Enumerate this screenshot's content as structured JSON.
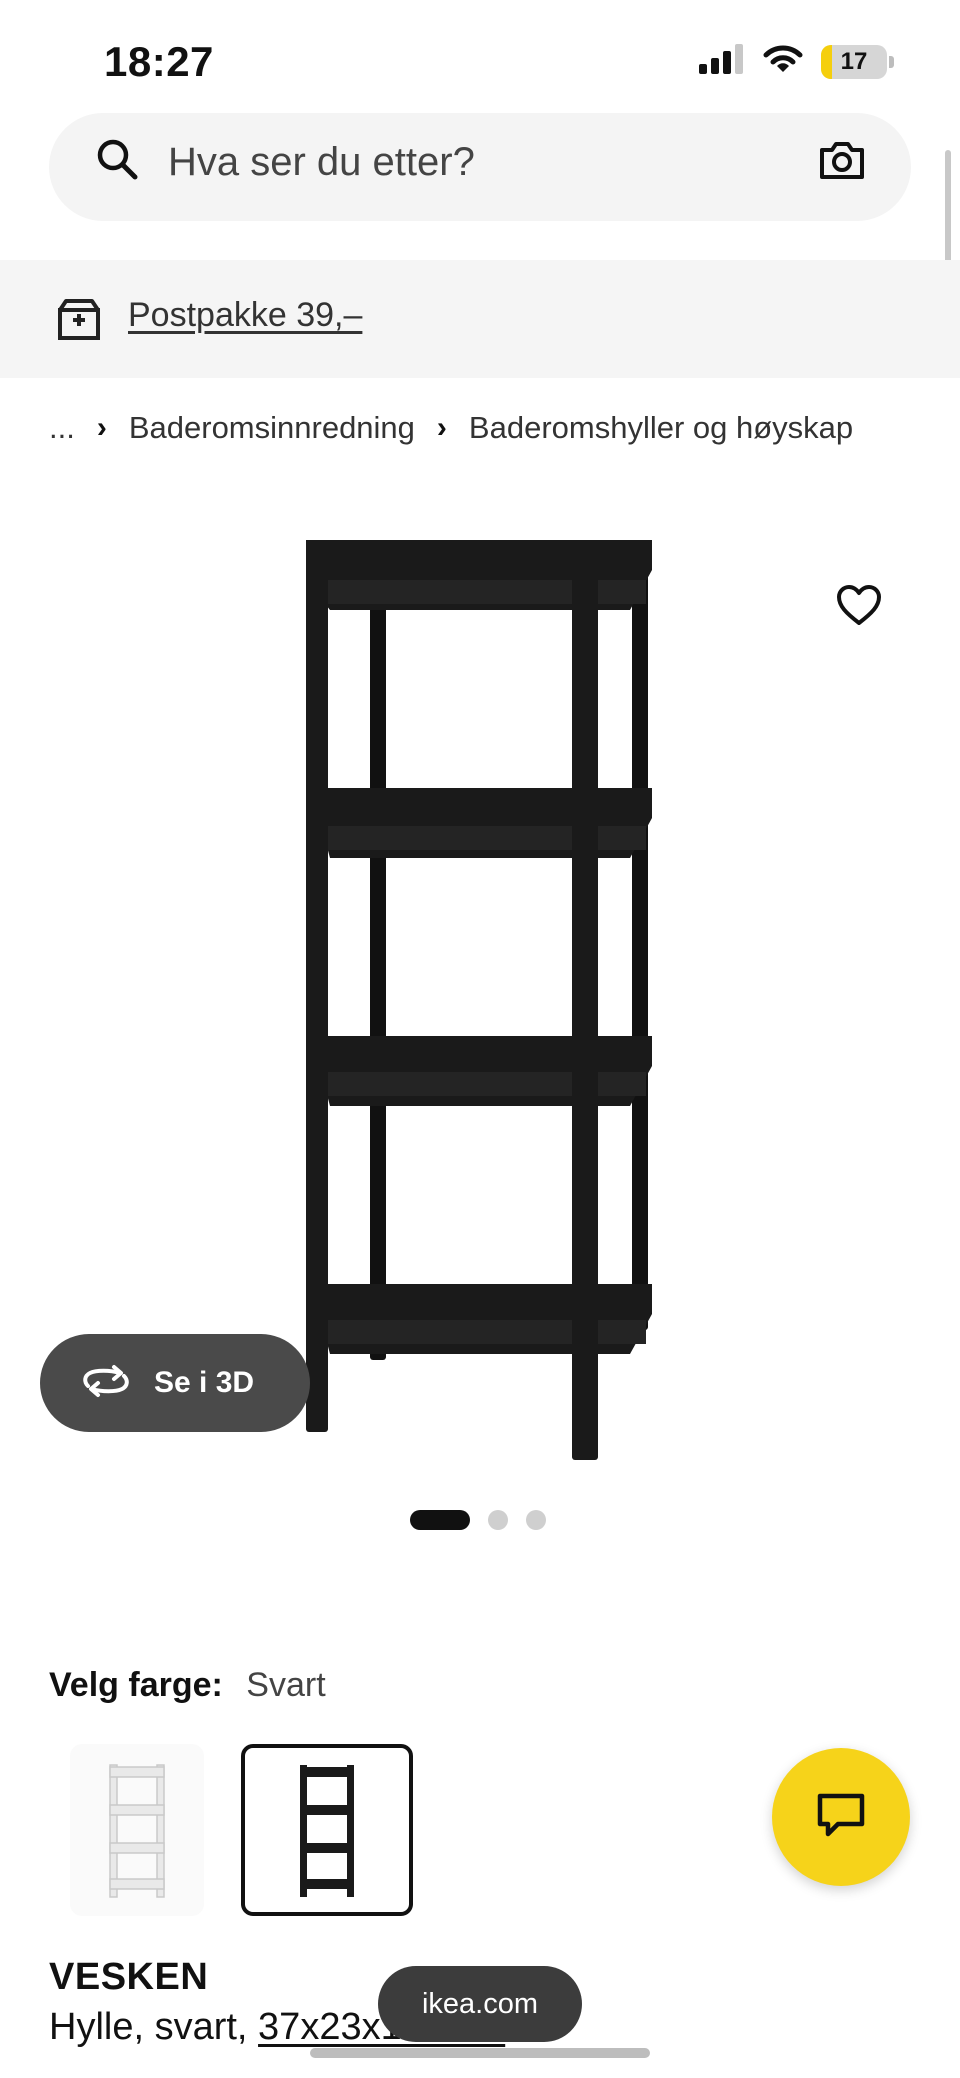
{
  "status_bar": {
    "time": "18:27",
    "battery_level": "17",
    "battery_fraction": 0.17,
    "signal_icon": "cellular-signal-icon",
    "wifi_icon": "wifi-icon"
  },
  "search": {
    "placeholder": "Hva ser du etter?",
    "search_icon": "search-icon",
    "camera_icon": "camera-icon"
  },
  "promo": {
    "icon": "package-box-icon",
    "text": "Postpakke 39,–"
  },
  "breadcrumb": {
    "ellipsis": "...",
    "items": [
      "Baderomsinnredning",
      "Baderomshyller og høyskap"
    ]
  },
  "gallery": {
    "view_3d_label": "Se i 3D",
    "total_images": 3,
    "active_index": 0,
    "favorite_icon": "heart-icon",
    "rotate_icon": "rotate-3d-icon"
  },
  "color_selector": {
    "label": "Velg farge:",
    "selected": "Svart",
    "options": [
      "white",
      "black"
    ],
    "selected_index": 1
  },
  "product": {
    "name": "VESKEN",
    "description_prefix": "Hylle, svart, ",
    "size": "37x23x101 cm"
  },
  "browser": {
    "url": "ikea.com"
  },
  "chat": {
    "icon": "chat-bubble-icon"
  },
  "colors": {
    "chat_fab": "#f6d31a",
    "battery": "#f5cf0d",
    "product": "#1a1a1a"
  }
}
